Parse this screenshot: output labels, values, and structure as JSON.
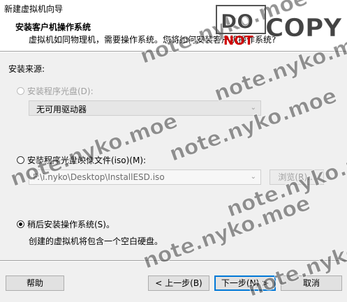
{
  "window": {
    "title": "新建虚拟机向导"
  },
  "header": {
    "title": "安装客户机操作系统",
    "subtitle": "虚拟机如同物理机，需要操作系统。您将如何安装客户机操作系统?"
  },
  "source": {
    "label": "安装来源:",
    "disc_option": {
      "label": "安装程序光盘(D):",
      "selected": false,
      "enabled": false
    },
    "drive_select": {
      "value": "无可用驱动器"
    },
    "iso_option": {
      "label": "安装程序光盘映像文件(iso)(M):",
      "selected": false
    },
    "iso_path": {
      "value": "F:\\i.nyko\\Desktop\\InstallESD.iso"
    },
    "browse_button": "浏览(R)...",
    "later_option": {
      "label": "稍后安装操作系统(S)。",
      "selected": true
    },
    "later_desc": "创建的虚拟机将包含一个空白硬盘。"
  },
  "footer": {
    "help": "帮助",
    "back": "< 上一步(B)",
    "next": "下一步(N) >",
    "cancel": "取消"
  },
  "watermarks": [
    "note.nyko.moe",
    "DO NOT COPY"
  ]
}
